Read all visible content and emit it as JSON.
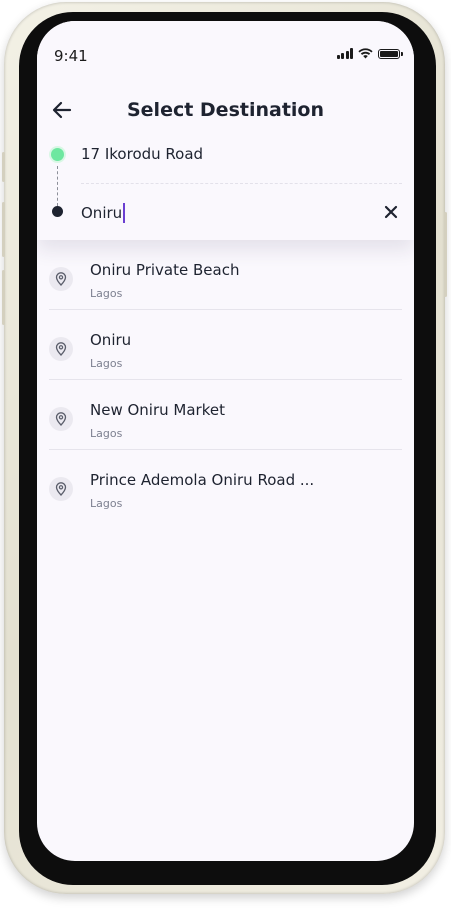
{
  "status_bar": {
    "time": "9:41"
  },
  "header": {
    "title": "Select Destination"
  },
  "route": {
    "origin": "17 Ikorodu Road",
    "destination_value": "Oniru"
  },
  "results": [
    {
      "name": "Oniru Private Beach",
      "city": "Lagos"
    },
    {
      "name": "Oniru",
      "city": "Lagos"
    },
    {
      "name": "New Oniru Market",
      "city": "Lagos"
    },
    {
      "name": "Prince Ademola Oniru Road ...",
      "city": "Lagos"
    }
  ],
  "colors": {
    "origin_dot": "#6ee7a0",
    "destination_dot": "#1e2330",
    "caret": "#6b3fd1",
    "screen_bg": "#faf8fd"
  },
  "icons": [
    "signal-icon",
    "wifi-icon",
    "battery-icon",
    "back-arrow-icon",
    "close-icon",
    "location-pin-icon"
  ]
}
